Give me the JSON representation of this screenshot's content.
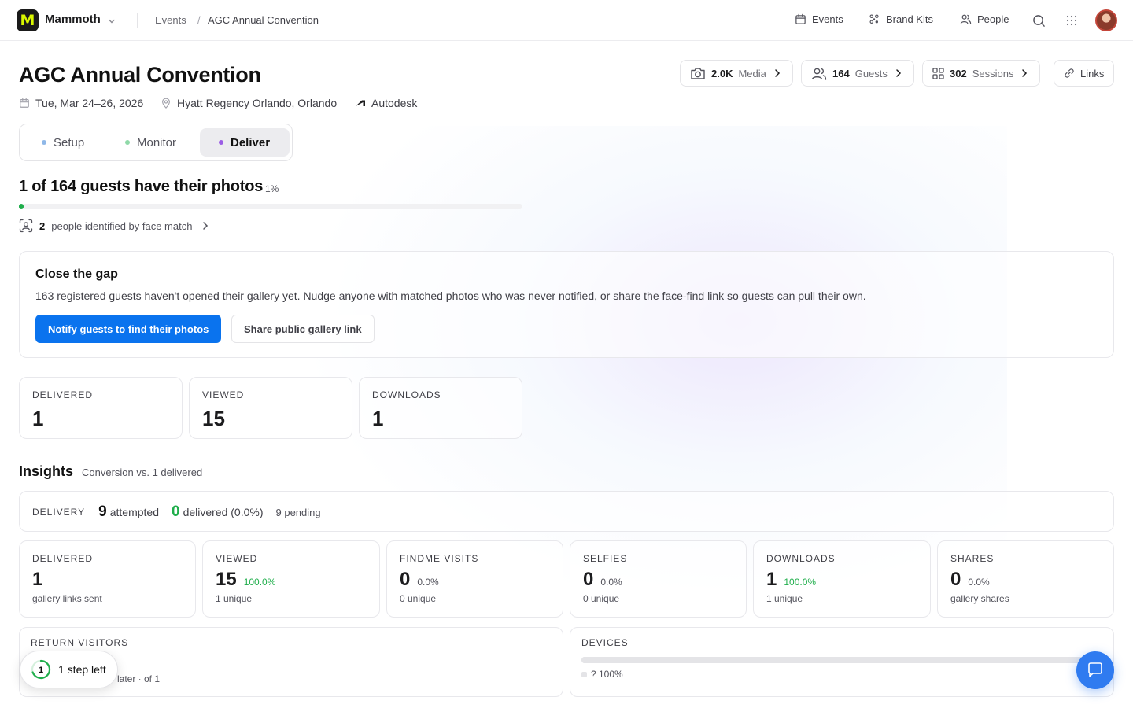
{
  "app": {
    "name": "Mammoth",
    "logo_letter": "M"
  },
  "breadcrumb": {
    "parent": "Events",
    "separator": "/",
    "current": "AGC Annual Convention"
  },
  "topnav": {
    "events": "Events",
    "brand_kits": "Brand Kits",
    "people": "People"
  },
  "event": {
    "title": "AGC Annual Convention",
    "date": "Tue, Mar 24–26, 2026",
    "venue": "Hyatt Regency Orlando, Orlando",
    "brand": "Autodesk"
  },
  "header_buttons": {
    "media": {
      "count": "2.0K",
      "label": "Media"
    },
    "guests": {
      "count": "164",
      "label": "Guests"
    },
    "sessions": {
      "count": "302",
      "label": "Sessions"
    },
    "links": {
      "label": "Links"
    }
  },
  "tabs": [
    {
      "label": "Setup",
      "dot_color": "#8fb8e8",
      "active": false
    },
    {
      "label": "Monitor",
      "dot_color": "#8fd9a8",
      "active": false
    },
    {
      "label": "Deliver",
      "dot_color": "#9b5de5",
      "active": true
    }
  ],
  "progress": {
    "title": "1 of 164 guests have their photos",
    "percent_label": "1%",
    "fraction": 0.01,
    "face_count": "2",
    "face_text": "people identified by face match"
  },
  "gap_card": {
    "title": "Close the gap",
    "body": "163 registered guests haven't opened their gallery yet. Nudge anyone with matched photos who was never notified, or share the face-find link so guests can pull their own.",
    "primary_button": "Notify guests to find their photos",
    "secondary_button": "Share public gallery link"
  },
  "summary_stats": [
    {
      "label": "DELIVERED",
      "value": "1"
    },
    {
      "label": "VIEWED",
      "value": "15"
    },
    {
      "label": "DOWNLOADS",
      "value": "1"
    }
  ],
  "insights": {
    "title": "Insights",
    "subtitle": "Conversion vs. 1 delivered",
    "delivery": {
      "label": "DELIVERY",
      "attempted_num": "9",
      "attempted_text": "attempted",
      "delivered_num": "0",
      "delivered_text": "delivered (0.0%)",
      "pending_text": "9 pending"
    },
    "metrics": [
      {
        "label": "DELIVERED",
        "value": "1",
        "pct": "",
        "pct_green": false,
        "sub": "gallery links sent"
      },
      {
        "label": "VIEWED",
        "value": "15",
        "pct": "100.0%",
        "pct_green": true,
        "sub": "1 unique"
      },
      {
        "label": "FINDME VISITS",
        "value": "0",
        "pct": "0.0%",
        "pct_green": false,
        "sub": "0 unique"
      },
      {
        "label": "SELFIES",
        "value": "0",
        "pct": "0.0%",
        "pct_green": false,
        "sub": "0 unique"
      },
      {
        "label": "DOWNLOADS",
        "value": "1",
        "pct": "100.0%",
        "pct_green": true,
        "sub": "1 unique"
      },
      {
        "label": "SHARES",
        "value": "0",
        "pct": "0.0%",
        "pct_green": false,
        "sub": "gallery shares"
      }
    ],
    "return_visitors": {
      "label": "RETURN VISITORS",
      "text": "later · of 1"
    },
    "devices": {
      "label": "DEVICES",
      "legend": "? 100%",
      "fraction": 1.0
    }
  },
  "onboarding": {
    "step_num": "1",
    "text": "1 step left"
  },
  "colors": {
    "primary": "#0a73ee",
    "success": "#1fae4b",
    "logo_bg": "#1a1a1a",
    "logo_fg": "#d9f700",
    "chat": "#2f7bf0"
  }
}
